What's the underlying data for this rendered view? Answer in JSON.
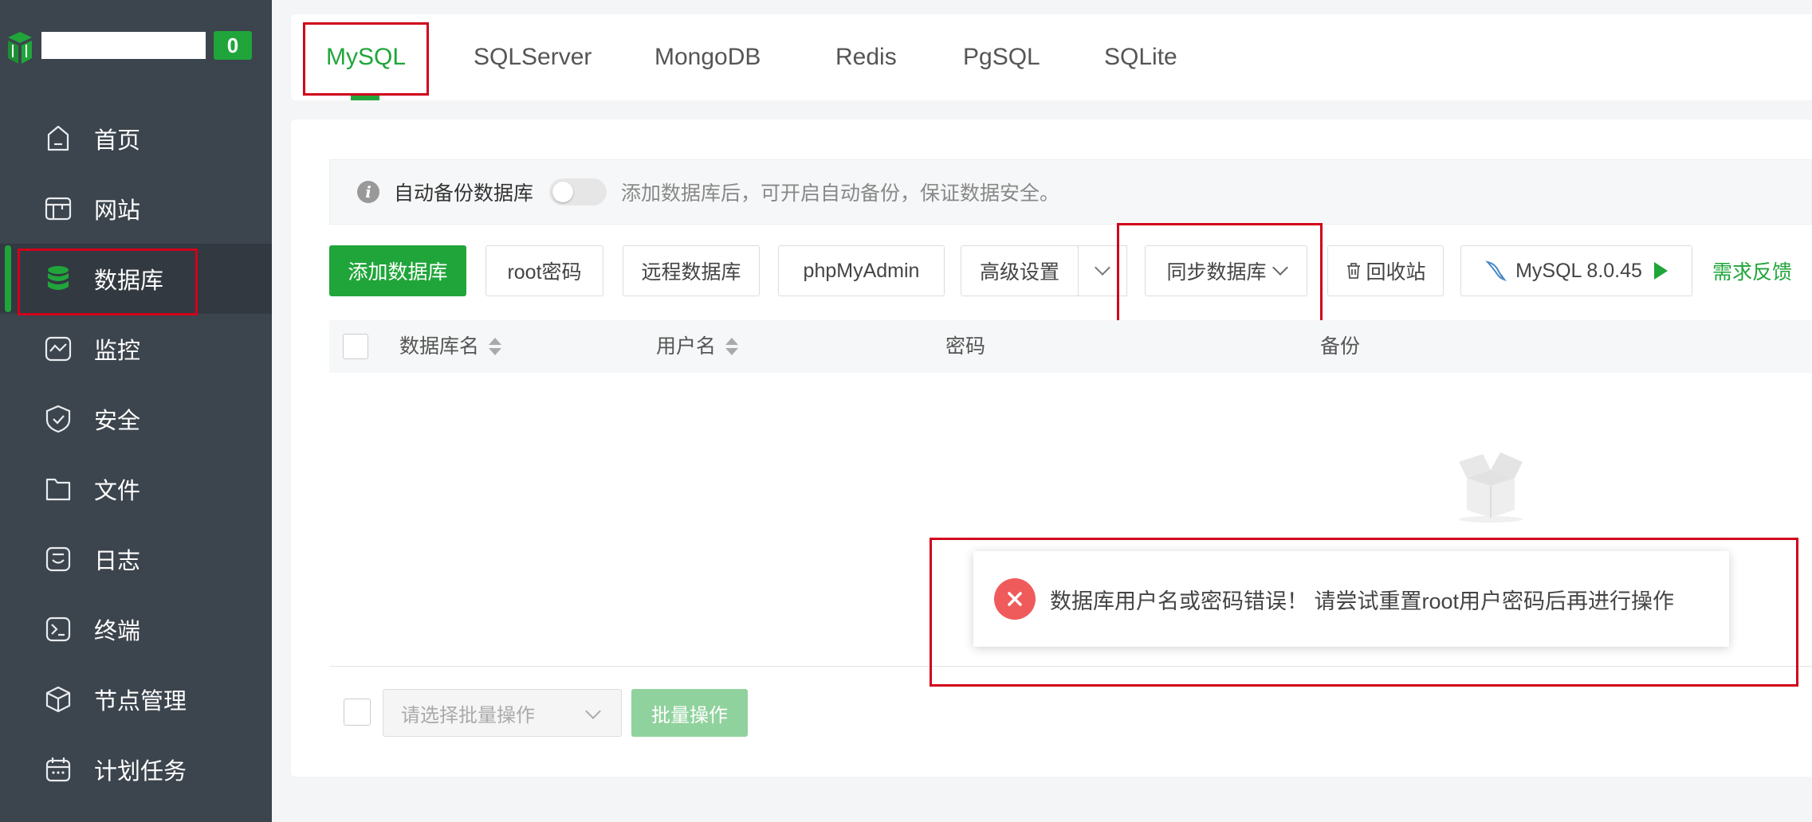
{
  "brand": {
    "badge_count": "0"
  },
  "sidebar": {
    "items": [
      {
        "label": "首页",
        "icon": "home-icon"
      },
      {
        "label": "网站",
        "icon": "website-icon"
      },
      {
        "label": "数据库",
        "icon": "database-icon",
        "active": true
      },
      {
        "label": "监控",
        "icon": "monitor-icon"
      },
      {
        "label": "安全",
        "icon": "shield-icon"
      },
      {
        "label": "文件",
        "icon": "folder-icon"
      },
      {
        "label": "日志",
        "icon": "log-icon"
      },
      {
        "label": "终端",
        "icon": "terminal-icon"
      },
      {
        "label": "节点管理",
        "icon": "cube-icon"
      },
      {
        "label": "计划任务",
        "icon": "calendar-icon"
      }
    ]
  },
  "tabs": [
    {
      "label": "MySQL",
      "active": true
    },
    {
      "label": "SQLServer"
    },
    {
      "label": "MongoDB"
    },
    {
      "label": "Redis"
    },
    {
      "label": "PgSQL"
    },
    {
      "label": "SQLite"
    }
  ],
  "notice": {
    "label": "自动备份数据库",
    "hint": "添加数据库后，可开启自动备份，保证数据安全。",
    "toggle_on": false
  },
  "toolbar": {
    "add": "添加数据库",
    "root_password": "root密码",
    "remote": "远程数据库",
    "phpmyadmin": "phpMyAdmin",
    "advanced": "高级设置",
    "sync": "同步数据库",
    "recycle": "回收站",
    "version": "MySQL 8.0.45",
    "feedback": "需求反馈"
  },
  "table": {
    "columns": [
      "数据库名",
      "用户名",
      "密码",
      "备份"
    ]
  },
  "footer": {
    "batch_placeholder": "请选择批量操作",
    "batch_button": "批量操作"
  },
  "toast": {
    "type": "error",
    "message": "数据库用户名或密码错误！ 请尝试重置root用户密码后再进行操作"
  },
  "colors": {
    "accent": "#20a53a",
    "sidebar_bg": "#3c444d",
    "error": "#ef5b5b",
    "highlight_box": "#d0021b"
  }
}
